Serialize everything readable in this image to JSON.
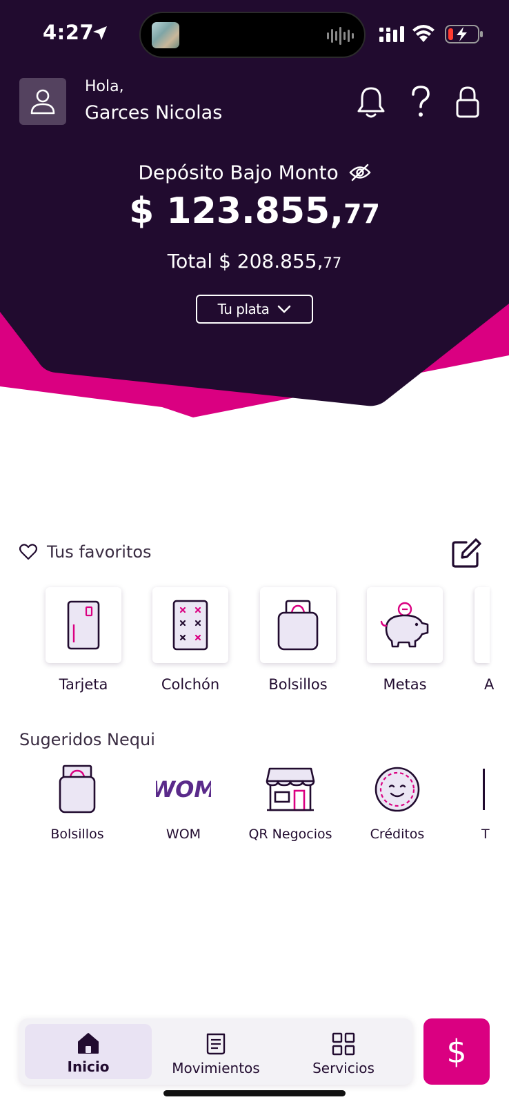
{
  "status_bar": {
    "time": "4:27"
  },
  "header": {
    "greeting": "Hola,",
    "user_name": "Garces Nicolas",
    "balance_label": "Depósito Bajo Monto",
    "balance_main": "$ 123.855,",
    "balance_cents": "77",
    "total_main": "Total $ 208.855,",
    "total_cents": "77",
    "tu_plata_label": "Tu plata"
  },
  "favorites": {
    "title": "Tus favoritos",
    "items": [
      {
        "label": "Tarjeta",
        "icon": "card-icon"
      },
      {
        "label": "Colchón",
        "icon": "mattress-icon"
      },
      {
        "label": "Bolsillos",
        "icon": "pocket-icon"
      },
      {
        "label": "Metas",
        "icon": "piggy-bank-icon"
      },
      {
        "label": "A",
        "icon": "partial-icon"
      }
    ]
  },
  "suggested": {
    "title": "Sugeridos Nequi",
    "items": [
      {
        "label": "Bolsillos",
        "icon": "pocket-icon"
      },
      {
        "label": "WOM",
        "icon": "wom-logo"
      },
      {
        "label": "QR Negocios",
        "icon": "store-icon"
      },
      {
        "label": "Créditos",
        "icon": "smiley-coin-icon"
      },
      {
        "label": "T",
        "icon": "partial-icon"
      }
    ],
    "wom_text": "WOM"
  },
  "bottom_nav": {
    "items": [
      {
        "label": "Inicio",
        "icon": "home-icon",
        "active": true
      },
      {
        "label": "Movimientos",
        "icon": "receipt-icon",
        "active": false
      },
      {
        "label": "Servicios",
        "icon": "grid-icon",
        "active": false
      }
    ],
    "pay_symbol": "$"
  },
  "colors": {
    "hero": "#210b2f",
    "accent": "#da0081",
    "wom": "#5a2a8a"
  }
}
